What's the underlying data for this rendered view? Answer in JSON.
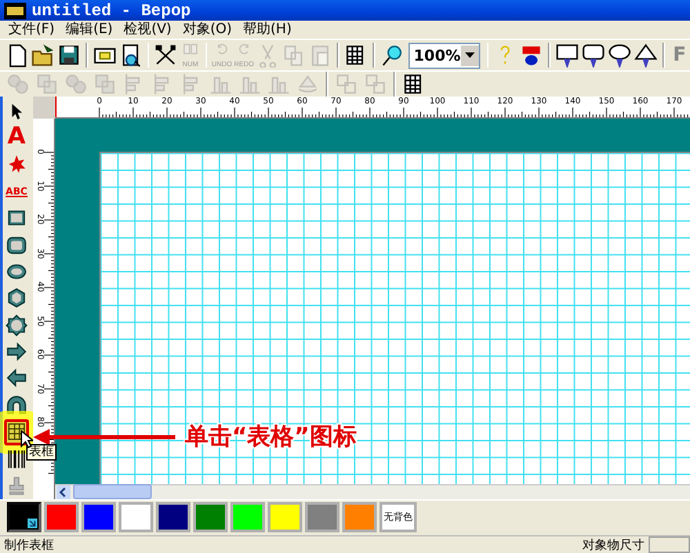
{
  "window": {
    "title": "untitled - Bepop"
  },
  "menu": [
    {
      "label": "文件(F)"
    },
    {
      "label": "编辑(E)"
    },
    {
      "label": "检视(V)"
    },
    {
      "label": "对象(O)"
    },
    {
      "label": "帮助(H)"
    }
  ],
  "toolbar": [
    {
      "kind": "new",
      "disabled": false
    },
    {
      "kind": "open",
      "disabled": false
    },
    {
      "kind": "save",
      "disabled": false
    },
    {
      "kind": "sep"
    },
    {
      "kind": "screen",
      "disabled": false
    },
    {
      "kind": "preview",
      "disabled": false
    },
    {
      "kind": "sep"
    },
    {
      "kind": "tools",
      "disabled": false
    },
    {
      "kind": "num",
      "label": "NUM",
      "disabled": true
    },
    {
      "kind": "sep"
    },
    {
      "kind": "undo",
      "label": "UNDO",
      "disabled": true
    },
    {
      "kind": "redo",
      "label": "REDO",
      "disabled": true
    },
    {
      "kind": "scissors",
      "disabled": true
    },
    {
      "kind": "copy",
      "disabled": true
    },
    {
      "kind": "paste",
      "disabled": true
    },
    {
      "kind": "sep"
    },
    {
      "kind": "grid",
      "disabled": false
    },
    {
      "kind": "sep"
    },
    {
      "kind": "zoom",
      "disabled": false
    },
    {
      "kind": "combo",
      "value": "100%"
    },
    {
      "kind": "sep"
    },
    {
      "kind": "help",
      "disabled": false
    },
    {
      "kind": "badge",
      "disabled": false
    },
    {
      "kind": "sep"
    },
    {
      "kind": "balloon-rect",
      "disabled": false
    },
    {
      "kind": "balloon-round",
      "disabled": false
    },
    {
      "kind": "balloon-cloud",
      "disabled": false
    },
    {
      "kind": "balloon-spike",
      "disabled": false
    },
    {
      "kind": "sep"
    },
    {
      "kind": "letter",
      "label": "F",
      "disabled": true
    }
  ],
  "toolbar_2": [
    {
      "kind": "circles",
      "disabled": true
    },
    {
      "kind": "squares",
      "disabled": true
    },
    {
      "kind": "circles",
      "disabled": true
    },
    {
      "kind": "squares",
      "disabled": true
    },
    {
      "kind": "align",
      "disabled": true
    },
    {
      "kind": "align",
      "disabled": true
    },
    {
      "kind": "align",
      "disabled": true
    },
    {
      "kind": "valign",
      "disabled": true
    },
    {
      "kind": "valign",
      "disabled": true
    },
    {
      "kind": "valign",
      "disabled": true
    },
    {
      "kind": "rotate",
      "disabled": true
    },
    {
      "kind": "sep"
    },
    {
      "kind": "group",
      "disabled": true
    },
    {
      "kind": "group",
      "disabled": true
    },
    {
      "kind": "sep"
    },
    {
      "kind": "grid",
      "disabled": false
    }
  ],
  "ruler": {
    "top_labels": [
      "0",
      "10",
      "20",
      "30",
      "40",
      "50",
      "60",
      "70",
      "80",
      "90",
      "100",
      "110",
      "120",
      "130",
      "140",
      "150",
      "160",
      "170"
    ],
    "side_labels": [
      "0",
      "10",
      "20",
      "30",
      "40",
      "50",
      "60",
      "70",
      "80"
    ]
  },
  "toolbox": [
    {
      "kind": "pointer",
      "selected": false
    },
    {
      "kind": "text",
      "label": "A",
      "selected": false
    },
    {
      "kind": "burst",
      "selected": false
    },
    {
      "kind": "wordart",
      "label": "ABC",
      "selected": false
    },
    {
      "kind": "rect",
      "selected": false
    },
    {
      "kind": "roundrect",
      "selected": false
    },
    {
      "kind": "ellipse",
      "selected": false
    },
    {
      "kind": "hexagon",
      "selected": false
    },
    {
      "kind": "octagon",
      "selected": false
    },
    {
      "kind": "arrow-right",
      "selected": false
    },
    {
      "kind": "arrow-left",
      "selected": false
    },
    {
      "kind": "arch",
      "selected": false
    },
    {
      "kind": "table",
      "selected": true
    },
    {
      "kind": "barcode",
      "selected": false
    },
    {
      "kind": "stamp",
      "selected": false
    }
  ],
  "tooltip": "表框",
  "annotation": "单击“表格”图标",
  "palette": [
    {
      "color": "#000000",
      "selected": true
    },
    {
      "color": "#ff0000",
      "selected": false
    },
    {
      "color": "#0000ff",
      "selected": false
    },
    {
      "color": "#ffffff",
      "selected": false
    },
    {
      "color": "#000080",
      "selected": false
    },
    {
      "color": "#008000",
      "selected": false
    },
    {
      "color": "#00ff00",
      "selected": false
    },
    {
      "color": "#ffff00",
      "selected": false
    },
    {
      "color": "#808080",
      "selected": false
    },
    {
      "color": "#ff8000",
      "selected": false
    }
  ],
  "no_fill": "无背色",
  "status_bar": {
    "message": "制作表框",
    "size_label": "对象物尺寸"
  }
}
